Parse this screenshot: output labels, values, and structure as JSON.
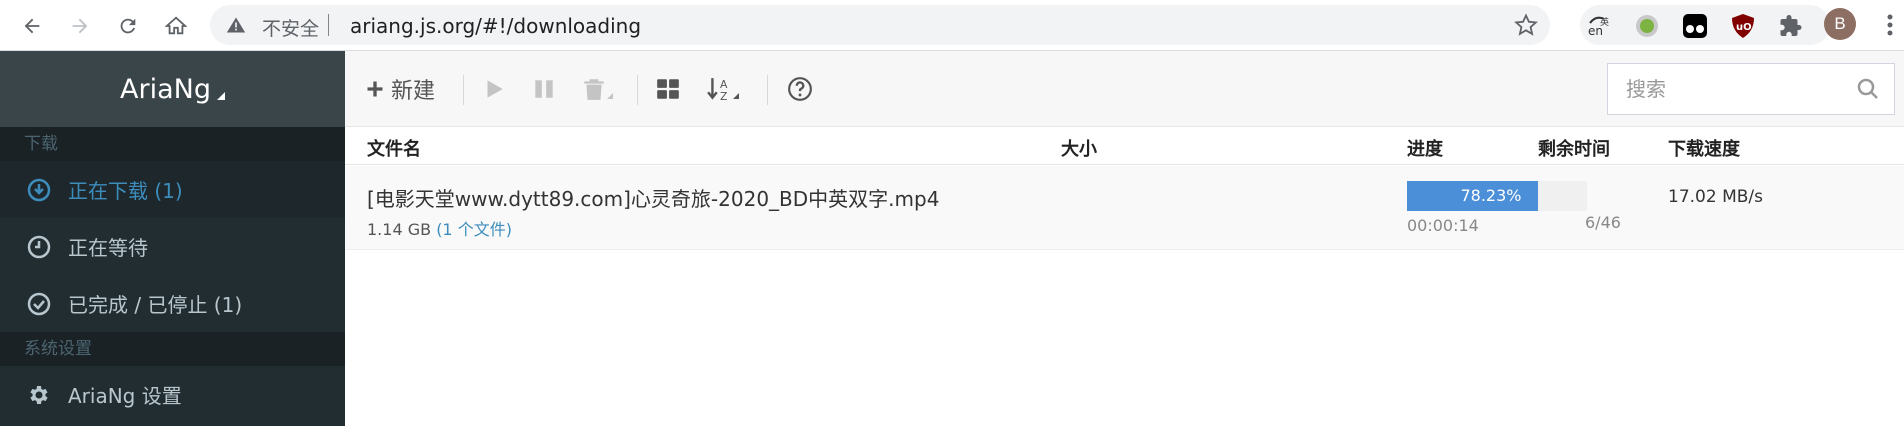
{
  "browser": {
    "insecure_label": "不安全",
    "url": "ariang.js.org/#!/downloading",
    "profile_initial": "B"
  },
  "brand": {
    "name": "AriaNg"
  },
  "sidebar": {
    "download_header": "下载",
    "items": [
      {
        "label": "正在下载 (1)",
        "icon": "download-circle-icon",
        "active": true
      },
      {
        "label": "正在等待",
        "icon": "clock-icon"
      },
      {
        "label": "已完成 / 已停止 (1)",
        "icon": "check-circle-icon"
      }
    ],
    "settings_header": "系统设置",
    "settings_items": [
      {
        "label": "AriaNg 设置",
        "icon": "gear-icon"
      }
    ]
  },
  "toolbar": {
    "new_label": "新建",
    "search_placeholder": "搜索"
  },
  "columns": {
    "name": "文件名",
    "size": "大小",
    "progress": "进度",
    "remaining": "剩余时间",
    "speed": "下载速度"
  },
  "tasks": [
    {
      "name": "[电影天堂www.dytt89.com]心灵奇旅-2020_BD中英双字.mp4",
      "size": "1.14 GB",
      "files": "(1 个文件)",
      "progress": 78.23,
      "progress_label": "78.23%",
      "remaining": "00:00:14",
      "connections": "6/46",
      "speed": "17.02 MB/s"
    }
  ],
  "colors": {
    "accent": "#3c8dbc",
    "sidebar_bg": "#222d32",
    "progress": "#4a8fd8"
  }
}
